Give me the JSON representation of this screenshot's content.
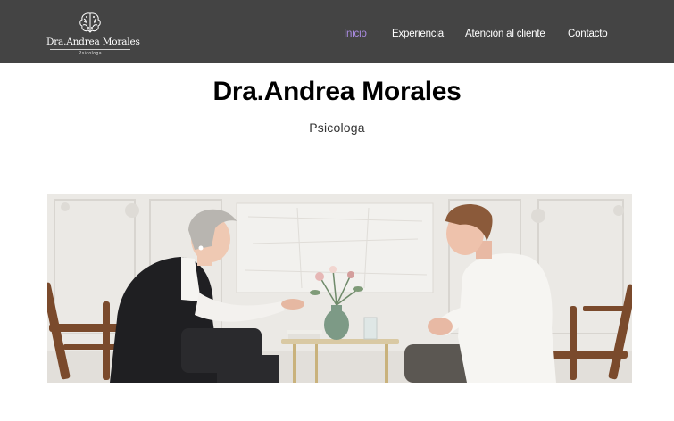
{
  "header": {
    "logo": {
      "name": "Dra.Andrea Morales",
      "subtitle": "Psicologa",
      "icon": "brain-icon"
    },
    "nav": [
      {
        "label": "Inicio",
        "active": true
      },
      {
        "label": "Experiencia",
        "active": false
      },
      {
        "label": "Atención al cliente",
        "active": false
      },
      {
        "label": "Contacto",
        "active": false
      }
    ]
  },
  "hero": {
    "title": "Dra.Andrea Morales",
    "subtitle": "Psicologa"
  },
  "colors": {
    "header_bg": "#444444",
    "nav_active": "#a98be0",
    "nav_text": "#ffffff"
  }
}
